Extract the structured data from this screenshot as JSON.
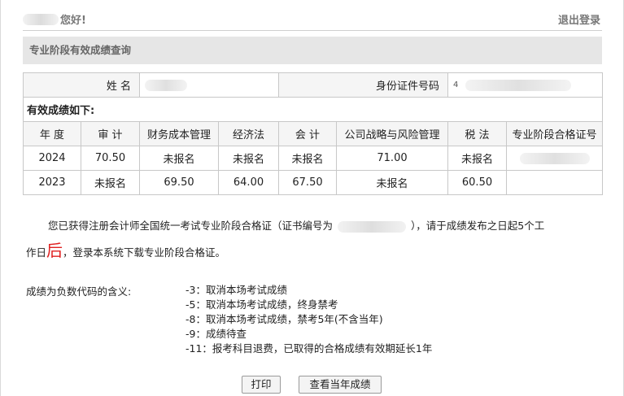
{
  "header": {
    "greeting": "您好!",
    "logout_label": "退出登录"
  },
  "section_title": "专业阶段有效成绩查询",
  "info": {
    "name_label": "姓 名",
    "id_label": "身份证件号码",
    "id_prefix": "4"
  },
  "scores": {
    "caption": "有效成绩如下:",
    "headers": [
      "年 度",
      "审 计",
      "财务成本管理",
      "经济法",
      "会 计",
      "公司战略与风险管理",
      "税 法",
      "专业阶段合格证号"
    ],
    "rows": [
      [
        "2024",
        "70.50",
        "未报名",
        "未报名",
        "未报名",
        "71.00",
        "未报名",
        ""
      ],
      [
        "2023",
        "未报名",
        "69.50",
        "64.00",
        "67.50",
        "未报名",
        "60.50",
        ""
      ]
    ]
  },
  "notice": {
    "part1": "您已获得注册会计师全国统一考试专业阶段合格证（证书编号为",
    "part2": "），请于成绩发布之日起5个工",
    "part3": "作日",
    "red_char": "后",
    "part4": "，登录本系统下载专业阶段合格证。"
  },
  "codes": {
    "label": "成绩为负数代码的含义:",
    "items": [
      "-3：取消本场考试成绩",
      "-5：取消本场考试成绩，终身禁考",
      "-8：取消本场考试成绩，禁考5年(不含当年)",
      "-9：成绩待查",
      "-11：报考科目退费，已取得的合格成绩有效期延长1年"
    ]
  },
  "buttons": {
    "print": "打印",
    "view_current": "查看当年成绩"
  }
}
